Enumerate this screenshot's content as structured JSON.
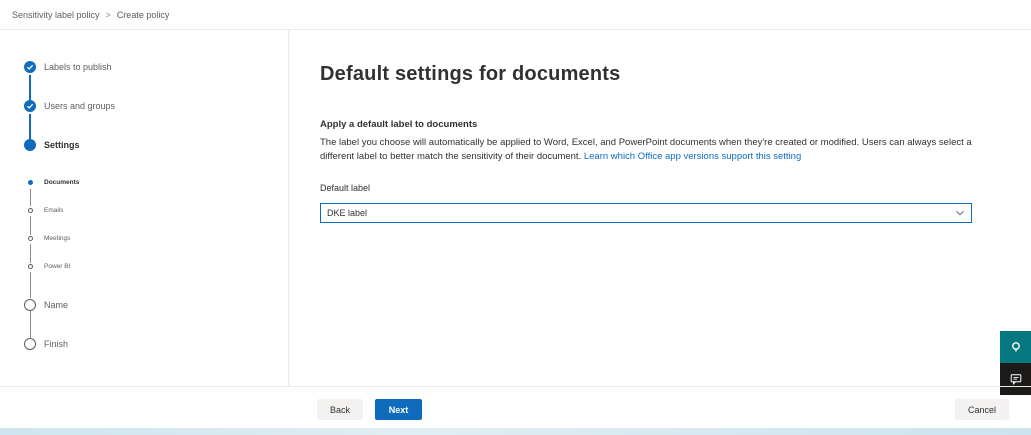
{
  "breadcrumb": {
    "parent": "Sensitivity label policy",
    "separator": ">",
    "current": "Create policy"
  },
  "steps": {
    "labels_to_publish": "Labels to publish",
    "users_and_groups": "Users and groups",
    "settings": "Settings",
    "sub_documents": "Documents",
    "sub_emails": "Emails",
    "sub_meetings": "Meetings",
    "sub_powerbi": "Power BI",
    "name": "Name",
    "finish": "Finish"
  },
  "main": {
    "title": "Default settings for documents",
    "section_title": "Apply a default label to documents",
    "description": "The label you choose will automatically be applied to Word, Excel, and PowerPoint documents when they're created or modified. Users can always select a different label to better match the sensitivity of their document. ",
    "description_link": "Learn which Office app versions support this setting",
    "field_label": "Default label",
    "dropdown_value": "DKE label"
  },
  "footer": {
    "back": "Back",
    "next": "Next",
    "cancel": "Cancel"
  },
  "colors": {
    "accent": "#0f6cbd",
    "teal": "#04787e",
    "dark": "#1b1a19"
  },
  "icons": {
    "breadcrumb_separator": "chevron-right-icon",
    "completed_step": "checkmark-icon",
    "dropdown": "chevron-down-icon",
    "help": "help-person-icon",
    "feedback": "feedback-icon"
  }
}
